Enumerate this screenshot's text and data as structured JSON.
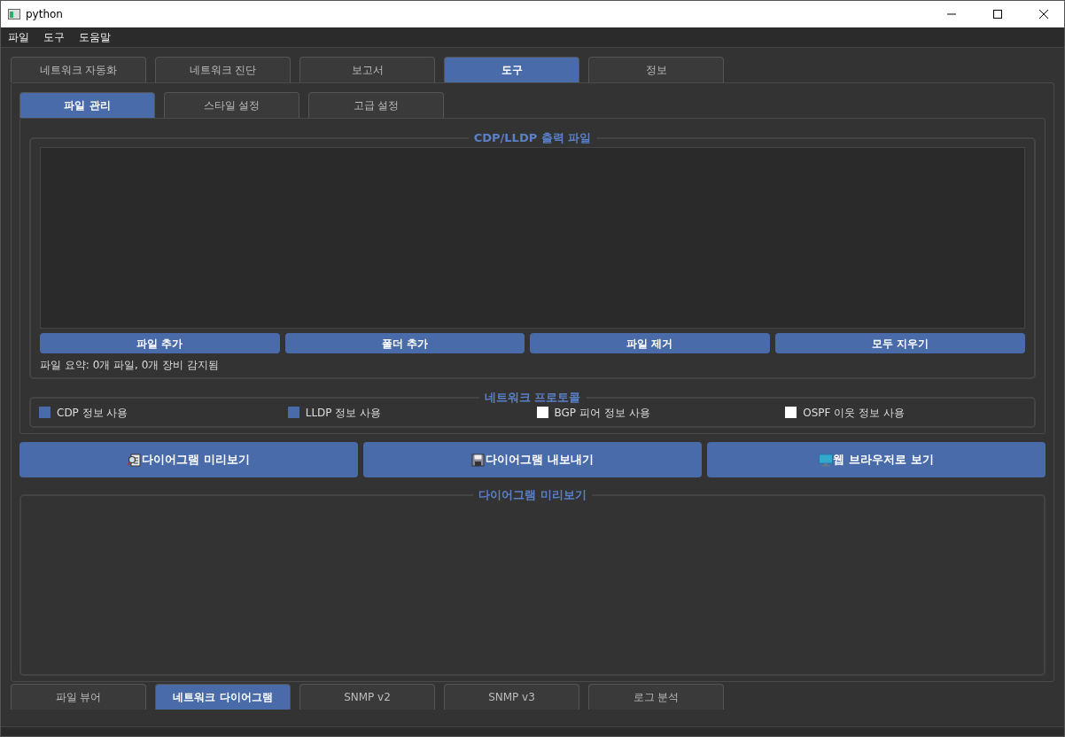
{
  "window": {
    "title": "python"
  },
  "menu": [
    "파일",
    "도구",
    "도움말"
  ],
  "tabs": [
    {
      "label": "네트워크 자동화",
      "selected": false
    },
    {
      "label": "네트워크 진단",
      "selected": false
    },
    {
      "label": "보고서",
      "selected": false
    },
    {
      "label": "도구",
      "selected": true
    },
    {
      "label": "정보",
      "selected": false
    }
  ],
  "sub_tabs": [
    {
      "label": "파일 관리",
      "selected": true
    },
    {
      "label": "스타일 설정",
      "selected": false
    },
    {
      "label": "고급 설정",
      "selected": false
    }
  ],
  "file_group": {
    "title": "CDP/LLDP 출력 파일",
    "buttons": [
      "파일 추가",
      "폴더 추가",
      "파일 제거",
      "모두 지우기"
    ],
    "summary": "파일 요약: 0개 파일, 0개 장비 감지됨"
  },
  "protocol_group": {
    "title": "네트워크 프로토콜",
    "options": [
      {
        "label": "CDP 정보 사용",
        "checked": true
      },
      {
        "label": "LLDP 정보 사용",
        "checked": true
      },
      {
        "label": "BGP 피어 정보 사용",
        "checked": false
      },
      {
        "label": "OSPF 이웃 정보 사용",
        "checked": false
      }
    ]
  },
  "actions": [
    {
      "label": "다이어그램 미리보기",
      "kind": "preview"
    },
    {
      "label": "다이어그램 내보내기",
      "kind": "export"
    },
    {
      "label": "웹 브라우저로 보기",
      "kind": "browser"
    }
  ],
  "preview_group": {
    "title": "다이어그램 미리보기"
  },
  "bottom_tabs": [
    {
      "label": "파일 뷰어",
      "selected": false
    },
    {
      "label": "네트워크 다이어그램",
      "selected": true
    },
    {
      "label": "SNMP v2",
      "selected": false
    },
    {
      "label": "SNMP v3",
      "selected": false
    },
    {
      "label": "로그 분석",
      "selected": false
    }
  ]
}
